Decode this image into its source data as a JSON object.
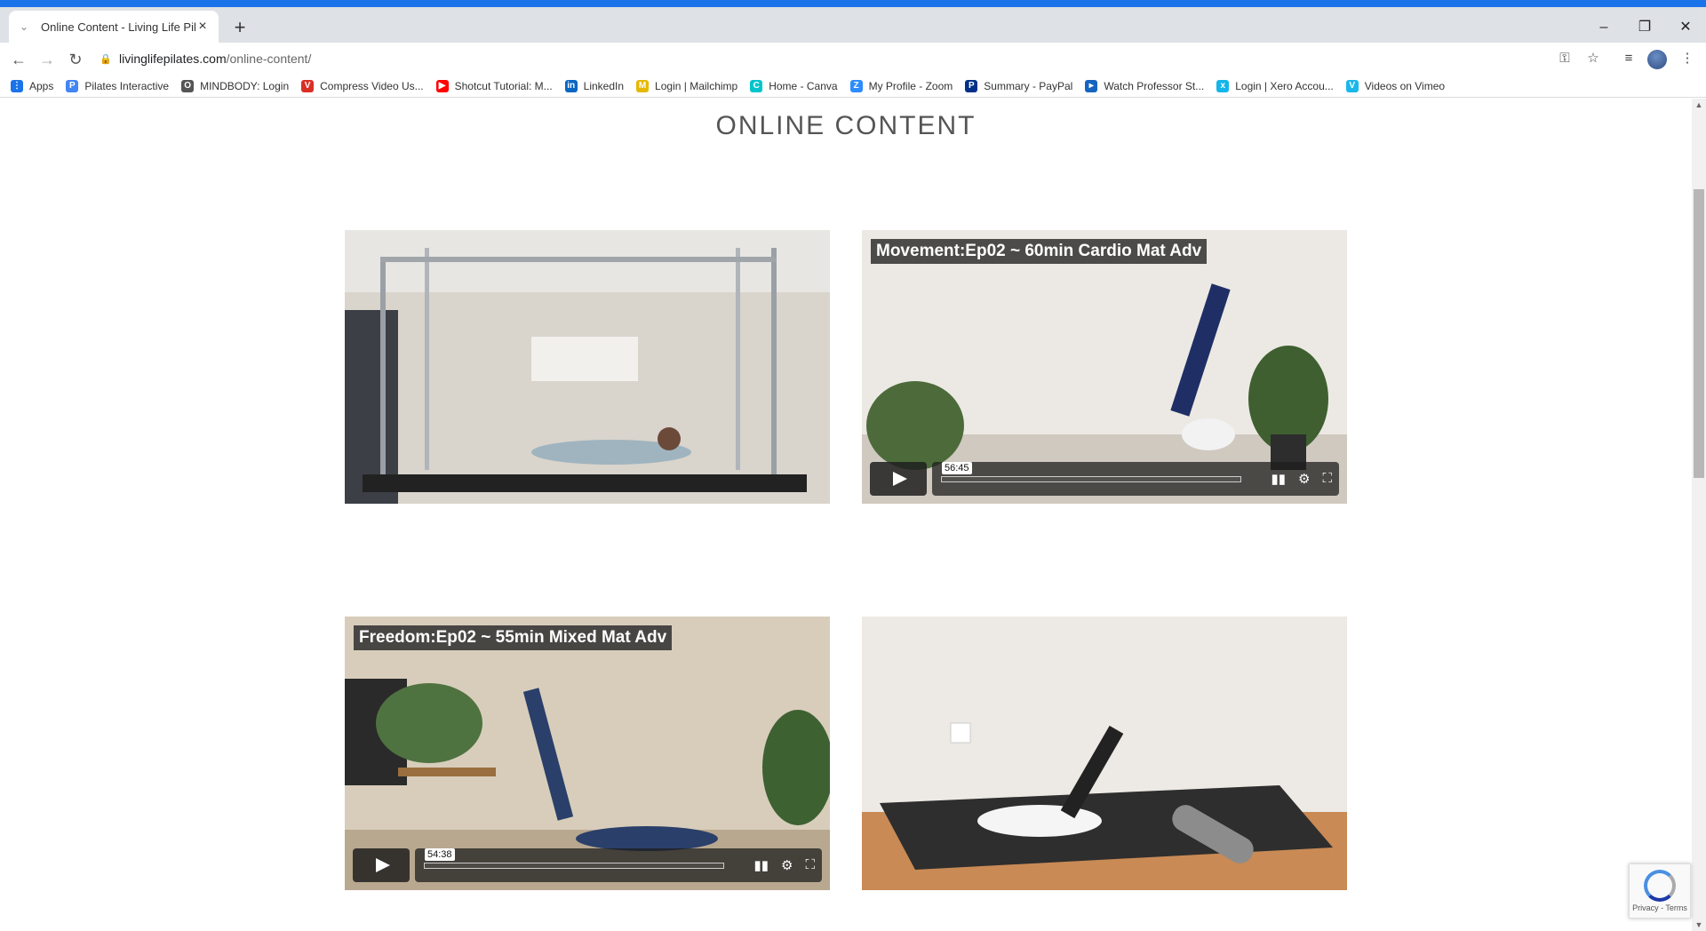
{
  "browser": {
    "tab_title": "Online Content - Living Life Pilat",
    "tab_close": "×",
    "new_tab": "+",
    "window": {
      "minimize": "–",
      "restore": "❐",
      "close": "✕"
    },
    "nav": {
      "back": "←",
      "forward": "→",
      "reload": "↻"
    },
    "url_host": "livinglifepilates.com",
    "url_path": "/online-content/",
    "bookmarks": [
      {
        "label": "Apps",
        "icon": "apps-grid-icon",
        "color": "#1a73e8",
        "glyph": "⋮"
      },
      {
        "label": "Pilates Interactive",
        "icon": "pilates-interactive-icon",
        "color": "#4285f4",
        "glyph": "P"
      },
      {
        "label": "MINDBODY: Login",
        "icon": "mindbody-icon",
        "color": "#555555",
        "glyph": "O"
      },
      {
        "label": "Compress Video Us...",
        "icon": "compress-video-icon",
        "color": "#d93025",
        "glyph": "V"
      },
      {
        "label": "Shotcut Tutorial: M...",
        "icon": "youtube-icon",
        "color": "#ff0000",
        "glyph": "▶"
      },
      {
        "label": "LinkedIn",
        "icon": "linkedin-icon",
        "color": "#0a66c2",
        "glyph": "in"
      },
      {
        "label": "Login | Mailchimp",
        "icon": "mailchimp-icon",
        "color": "#e6b800",
        "glyph": "M"
      },
      {
        "label": "Home - Canva",
        "icon": "canva-icon",
        "color": "#00c4cc",
        "glyph": "C"
      },
      {
        "label": "My Profile - Zoom",
        "icon": "zoom-icon",
        "color": "#2d8cff",
        "glyph": "Z"
      },
      {
        "label": "Summary - PayPal",
        "icon": "paypal-icon",
        "color": "#003087",
        "glyph": "P"
      },
      {
        "label": "Watch Professor St...",
        "icon": "watch-icon",
        "color": "#1565c0",
        "glyph": "▸"
      },
      {
        "label": "Login | Xero Accou...",
        "icon": "xero-icon",
        "color": "#13b5ea",
        "glyph": "x"
      },
      {
        "label": "Videos on Vimeo",
        "icon": "vimeo-icon",
        "color": "#1ab7ea",
        "glyph": "V"
      }
    ]
  },
  "page": {
    "heading": "ONLINE CONTENT",
    "videos": [
      {
        "title": "",
        "time": "",
        "scene": "cadillac"
      },
      {
        "title": "Movement:Ep02 ~ 60min Cardio Mat Adv",
        "time": "56:45",
        "scene": "shoulderstand"
      },
      {
        "title": "Freedom:Ep02 ~ 55min Mixed Mat Adv",
        "time": "54:38",
        "scene": "legraise"
      },
      {
        "title": "",
        "time": "",
        "scene": "foamroller"
      }
    ]
  },
  "recaptcha": {
    "text": "Privacy - Terms"
  }
}
